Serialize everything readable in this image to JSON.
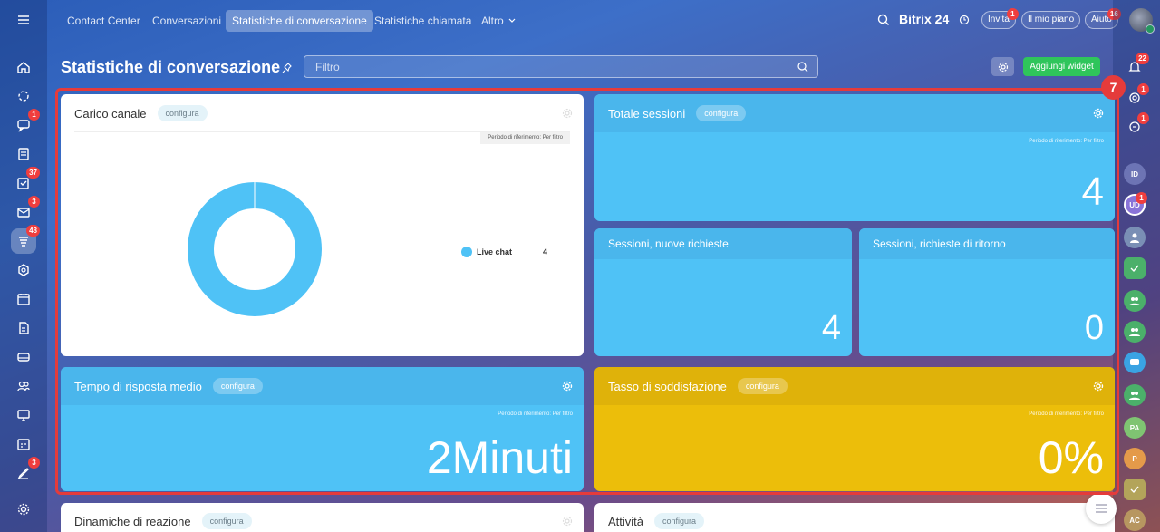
{
  "topnav": {
    "tabs": [
      {
        "label": "Contact Center"
      },
      {
        "label": "Conversazioni"
      },
      {
        "label": "Statistiche di conversazione"
      },
      {
        "label": "Statistiche chiamata"
      },
      {
        "label": "Altro"
      }
    ],
    "brand": "Bitrix 24",
    "invite_label": "Invita",
    "invite_badge": "1",
    "plan_label": "Il mio piano",
    "help_label": "Aiuto",
    "help_badge": "16"
  },
  "left_sidebar": {
    "badges": {
      "chat": "1",
      "tasks": "37",
      "mail": "3",
      "contact_center": "48",
      "feed": "3"
    }
  },
  "right_sidebar": {
    "notifications_badge": "22",
    "item2_badge": "1",
    "item3_badge": "1",
    "ud_badge": "1",
    "avatars": [
      "ID",
      "UD",
      "PA",
      "P",
      "AC"
    ]
  },
  "header": {
    "title": "Statistiche di conversazione",
    "filter_placeholder": "Filtro",
    "add_widget_label": "Aggiungi widget"
  },
  "step_marker": "7",
  "widgets": {
    "carico": {
      "title": "Carico canale",
      "configure": "configura",
      "period": "Periodo di riferimento: Per filtro",
      "legend_label": "Live chat",
      "legend_value": "4"
    },
    "totale": {
      "title": "Totale sessioni",
      "configure": "configura",
      "period": "Periodo di riferimento: Per filtro",
      "value": "4"
    },
    "nuove": {
      "title": "Sessioni, nuove richieste",
      "value": "4"
    },
    "ritorno": {
      "title": "Sessioni, richieste di ritorno",
      "value": "0"
    },
    "tempo": {
      "title": "Tempo di risposta medio",
      "configure": "configura",
      "period": "Periodo di riferimento: Per filtro",
      "value": "2Minuti"
    },
    "tasso": {
      "title": "Tasso di soddisfazione",
      "configure": "configura",
      "period": "Periodo di riferimento: Per filtro",
      "value": "0%"
    },
    "dinamiche": {
      "title": "Dinamiche di reazione",
      "configure": "configura"
    },
    "attivita": {
      "title": "Attività",
      "configure": "configura"
    }
  },
  "colors": {
    "widget_blue": "#4fc2f6",
    "widget_yellow": "#ecbe0a",
    "accent_green": "#2fc55b",
    "highlight_red": "#e53b3b"
  },
  "chart_data": {
    "type": "pie",
    "categories": [
      "Live chat"
    ],
    "values": [
      4
    ]
  }
}
